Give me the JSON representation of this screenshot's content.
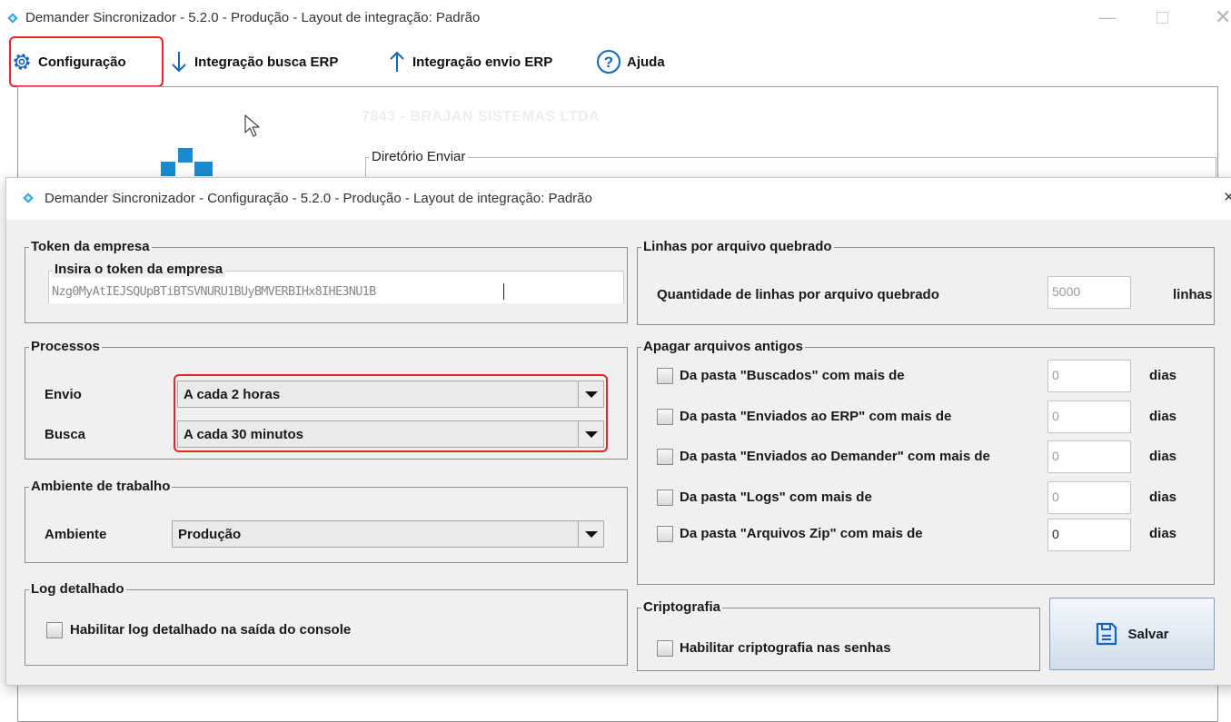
{
  "main_window": {
    "title": "Demander Sincronizador - 5.2.0 - Produção - Layout de integração: Padrão",
    "menu": {
      "configuracao": "Configuração",
      "integracao_busca": "Integração busca ERP",
      "integracao_envio": "Integração envio ERP",
      "ajuda": "Ajuda"
    },
    "company": "7843 - BRAJAN SISTEMAS LTDA",
    "diretorio_enviar_label": "Diretório Enviar"
  },
  "dialog": {
    "title": "Demander Sincronizador - Configuração - 5.2.0 - Produção - Layout de integração: Padrão",
    "close": "×",
    "token": {
      "legend": "Token da empresa",
      "inner_legend": "Insira o token da empresa",
      "value": "Nzg0MyAtIEJSQUpBTiBTSVNURU1BUyBMVERBIHx8IHE3NU1B"
    },
    "processos": {
      "legend": "Processos",
      "envio_label": "Envio",
      "envio_value": "A cada 2 horas",
      "busca_label": "Busca",
      "busca_value": "A cada 30 minutos"
    },
    "ambiente": {
      "legend": "Ambiente de trabalho",
      "label": "Ambiente",
      "value": "Produção"
    },
    "log": {
      "legend": "Log detalhado",
      "checkbox_label": "Habilitar log detalhado na saída do console",
      "checked": false
    },
    "linhas": {
      "legend": "Linhas por arquivo quebrado",
      "label": "Quantidade de linhas por arquivo quebrado",
      "value": "5000",
      "unit": "linhas"
    },
    "apagar": {
      "legend": "Apagar arquivos antigos",
      "unit": "dias",
      "items": [
        {
          "label": "Da pasta \"Buscados\" com mais de",
          "value": "0",
          "checked": false
        },
        {
          "label": "Da pasta \"Enviados ao ERP\" com mais de",
          "value": "0",
          "checked": false
        },
        {
          "label": "Da pasta \"Enviados ao Demander\" com mais de",
          "value": "0",
          "checked": false
        },
        {
          "label": "Da pasta \"Logs\" com mais de",
          "value": "0",
          "checked": false
        },
        {
          "label": "Da pasta \"Arquivos Zip\" com mais de",
          "value": "0",
          "checked": false
        }
      ]
    },
    "cripto": {
      "legend": "Criptografia",
      "checkbox_label": "Habilitar criptografia nas senhas",
      "checked": false
    },
    "save_label": "Salvar"
  },
  "colors": {
    "highlight": "#e8232a",
    "accent": "#1a8ad0",
    "dialog_bg": "#f0f0f0"
  }
}
